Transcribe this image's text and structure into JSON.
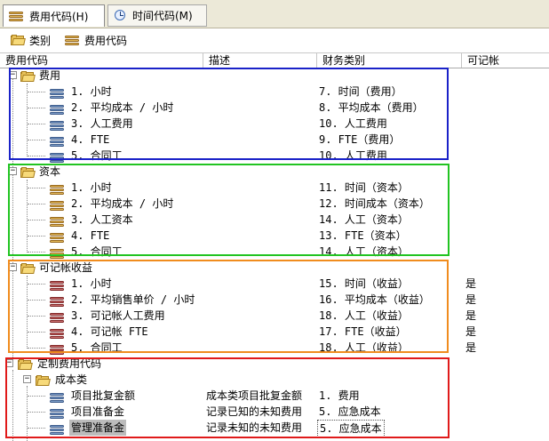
{
  "tabs": [
    {
      "label": "费用代码(H)"
    },
    {
      "label": "时间代码(M)"
    }
  ],
  "breadcrumb": {
    "item1": "类别",
    "item2": "费用代码"
  },
  "columns": {
    "code": "费用代码",
    "desc": "描述",
    "category": "财务类别",
    "billable": "可记帐"
  },
  "groups": [
    {
      "label": "费用",
      "items": [
        {
          "name": "1. 小时",
          "desc": "",
          "category": "7. 时间（费用）",
          "billable": ""
        },
        {
          "name": "2. 平均成本 / 小时",
          "desc": "",
          "category": "8. 平均成本（费用）",
          "billable": ""
        },
        {
          "name": "3. 人工费用",
          "desc": "",
          "category": "10. 人工费用",
          "billable": ""
        },
        {
          "name": "4. FTE",
          "desc": "",
          "category": "9. FTE（费用）",
          "billable": ""
        },
        {
          "name": "5. 合同工",
          "desc": "",
          "category": "10. 人工费用",
          "billable": ""
        }
      ]
    },
    {
      "label": "资本",
      "items": [
        {
          "name": "1. 小时",
          "desc": "",
          "category": "11. 时间（资本）",
          "billable": ""
        },
        {
          "name": "2. 平均成本 / 小时",
          "desc": "",
          "category": "12. 时间成本（资本）",
          "billable": ""
        },
        {
          "name": "3. 人工资本",
          "desc": "",
          "category": "14. 人工（资本）",
          "billable": ""
        },
        {
          "name": "4. FTE",
          "desc": "",
          "category": "13. FTE（资本）",
          "billable": ""
        },
        {
          "name": "5. 合同工",
          "desc": "",
          "category": "14. 人工（资本）",
          "billable": ""
        }
      ]
    },
    {
      "label": "可记帐收益",
      "items": [
        {
          "name": "1. 小时",
          "desc": "",
          "category": "15. 时间（收益）",
          "billable": "是"
        },
        {
          "name": "2. 平均销售单价 / 小时",
          "desc": "",
          "category": "16. 平均成本（收益）",
          "billable": "是"
        },
        {
          "name": "3. 可记帐人工费用",
          "desc": "",
          "category": "18. 人工（收益）",
          "billable": "是"
        },
        {
          "name": "4. 可记帐 FTE",
          "desc": "",
          "category": "17. FTE（收益）",
          "billable": "是"
        },
        {
          "name": "5. 合同工",
          "desc": "",
          "category": "18. 人工（收益）",
          "billable": "是"
        }
      ]
    }
  ],
  "custom": {
    "label": "定制费用代码",
    "subgroup": "成本类",
    "items": [
      {
        "name": "项目批复金额",
        "desc": "成本类项目批复金额",
        "category": "1. 费用"
      },
      {
        "name": "项目准备金",
        "desc": "记录已知的未知费用",
        "category": "5. 应急成本"
      },
      {
        "name": "管理准备金",
        "desc": "记录未知的未知费用",
        "category": "5. 应急成本"
      }
    ]
  },
  "expander_collapse_symbol": "−",
  "highlight_colors": {
    "blue": "#1a22c8",
    "green": "#22c422",
    "orange": "#f08c1e",
    "red": "#e01a1a"
  },
  "icons": {
    "tab1": "stack-icon",
    "tab2": "clock-icon",
    "folder": "folder-icon"
  }
}
